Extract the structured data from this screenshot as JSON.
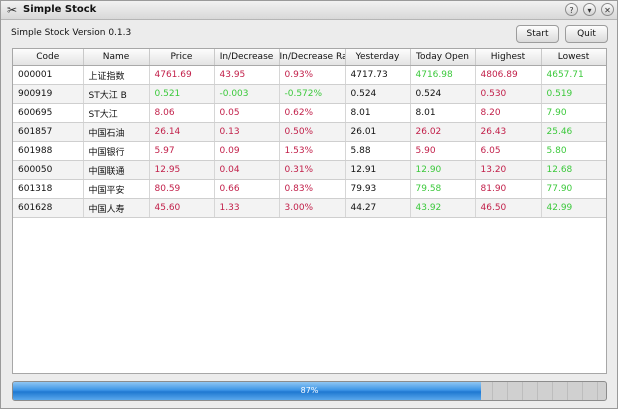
{
  "window": {
    "title": "Simple Stock"
  },
  "app": {
    "version_label": "Simple Stock Version 0.1.3",
    "start_label": "Start",
    "quit_label": "Quit"
  },
  "table": {
    "columns": [
      "Code",
      "Name",
      "Price",
      "In/Decrease",
      "In/Decrease Rat",
      "Yesterday",
      "Today Open",
      "Highest",
      "Lowest"
    ],
    "rows": [
      {
        "code": "000001",
        "name": "上证指数",
        "price": "4761.69",
        "change": "43.95",
        "rate": "0.93%",
        "yesterday": "4717.73",
        "open": "4716.98",
        "high": "4806.89",
        "low": "4657.71",
        "colors": {
          "price": "up",
          "change": "up",
          "rate": "up",
          "open": "down",
          "high": "up",
          "low": "down"
        }
      },
      {
        "code": "900919",
        "name": "ST大江 B",
        "price": "0.521",
        "change": "-0.003",
        "rate": "-0.572%",
        "yesterday": "0.524",
        "open": "0.524",
        "high": "0.530",
        "low": "0.519",
        "colors": {
          "price": "down",
          "change": "down",
          "rate": "down",
          "open": "flat",
          "high": "up",
          "low": "down"
        }
      },
      {
        "code": "600695",
        "name": "ST大江",
        "price": "8.06",
        "change": "0.05",
        "rate": "0.62%",
        "yesterday": "8.01",
        "open": "8.01",
        "high": "8.20",
        "low": "7.90",
        "colors": {
          "price": "up",
          "change": "up",
          "rate": "up",
          "open": "flat",
          "high": "up",
          "low": "down"
        }
      },
      {
        "code": "601857",
        "name": "中国石油",
        "price": "26.14",
        "change": "0.13",
        "rate": "0.50%",
        "yesterday": "26.01",
        "open": "26.02",
        "high": "26.43",
        "low": "25.46",
        "colors": {
          "price": "up",
          "change": "up",
          "rate": "up",
          "open": "up",
          "high": "up",
          "low": "down"
        }
      },
      {
        "code": "601988",
        "name": "中国银行",
        "price": "5.97",
        "change": "0.09",
        "rate": "1.53%",
        "yesterday": "5.88",
        "open": "5.90",
        "high": "6.05",
        "low": "5.80",
        "colors": {
          "price": "up",
          "change": "up",
          "rate": "up",
          "open": "up",
          "high": "up",
          "low": "down"
        }
      },
      {
        "code": "600050",
        "name": "中国联通",
        "price": "12.95",
        "change": "0.04",
        "rate": "0.31%",
        "yesterday": "12.91",
        "open": "12.90",
        "high": "13.20",
        "low": "12.68",
        "colors": {
          "price": "up",
          "change": "up",
          "rate": "up",
          "open": "down",
          "high": "up",
          "low": "down"
        }
      },
      {
        "code": "601318",
        "name": "中国平安",
        "price": "80.59",
        "change": "0.66",
        "rate": "0.83%",
        "yesterday": "79.93",
        "open": "79.58",
        "high": "81.90",
        "low": "77.90",
        "colors": {
          "price": "up",
          "change": "up",
          "rate": "up",
          "open": "down",
          "high": "up",
          "low": "down"
        }
      },
      {
        "code": "601628",
        "name": "中国人寿",
        "price": "45.60",
        "change": "1.33",
        "rate": "3.00%",
        "yesterday": "44.27",
        "open": "43.92",
        "high": "46.50",
        "low": "42.99",
        "colors": {
          "price": "up",
          "change": "up",
          "rate": "up",
          "open": "down",
          "high": "up",
          "low": "down"
        }
      }
    ]
  },
  "progress": {
    "value": 0.79,
    "label": "87%"
  },
  "colors": {
    "up": "#c2204a",
    "down": "#3cc93c",
    "progress_fill": "#2f86dc"
  }
}
